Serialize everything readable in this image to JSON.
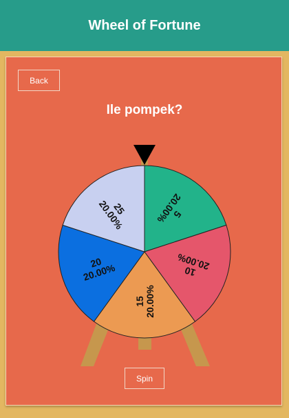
{
  "header": {
    "title": "Wheel of Fortune"
  },
  "back_label": "Back",
  "question": "Ile pompek?",
  "spin_label": "Spin",
  "colors": {
    "header": "#279c8a",
    "page_bg": "#e3b761",
    "panel": "#e7694b",
    "stand": "#c6974d",
    "pointer": "#000000"
  },
  "wheel": {
    "segments": [
      {
        "label": "5",
        "percent": "20.00%",
        "color": "#22b38a"
      },
      {
        "label": "10",
        "percent": "20.00%",
        "color": "#e5566b"
      },
      {
        "label": "15",
        "percent": "20.00%",
        "color": "#ec9a52"
      },
      {
        "label": "20",
        "percent": "20.00%",
        "color": "#0b6fe0"
      },
      {
        "label": "25",
        "percent": "20.00%",
        "color": "#c8d0f0"
      }
    ]
  }
}
